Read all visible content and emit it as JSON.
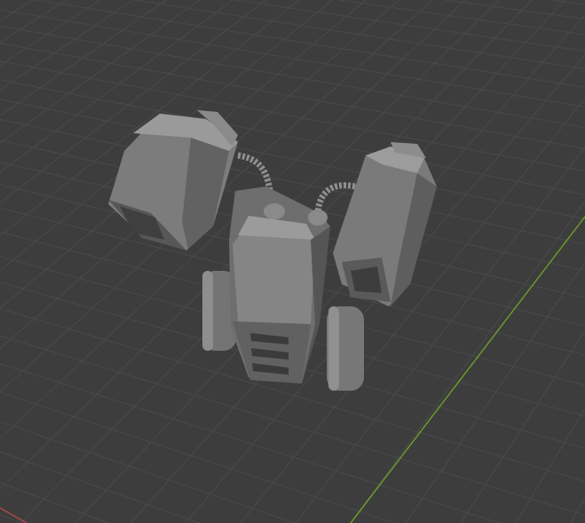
{
  "viewport": {
    "background": "#3d3d3d",
    "grid_color": "#4a4a4a",
    "x_axis_color": "#b0464c",
    "y_axis_color": "#6a9a2a"
  },
  "model": {
    "name_icon": "jetpack-model",
    "base_color": "#7a7a7a",
    "light_color": "#9a9a9a",
    "dark_color": "#555555"
  }
}
